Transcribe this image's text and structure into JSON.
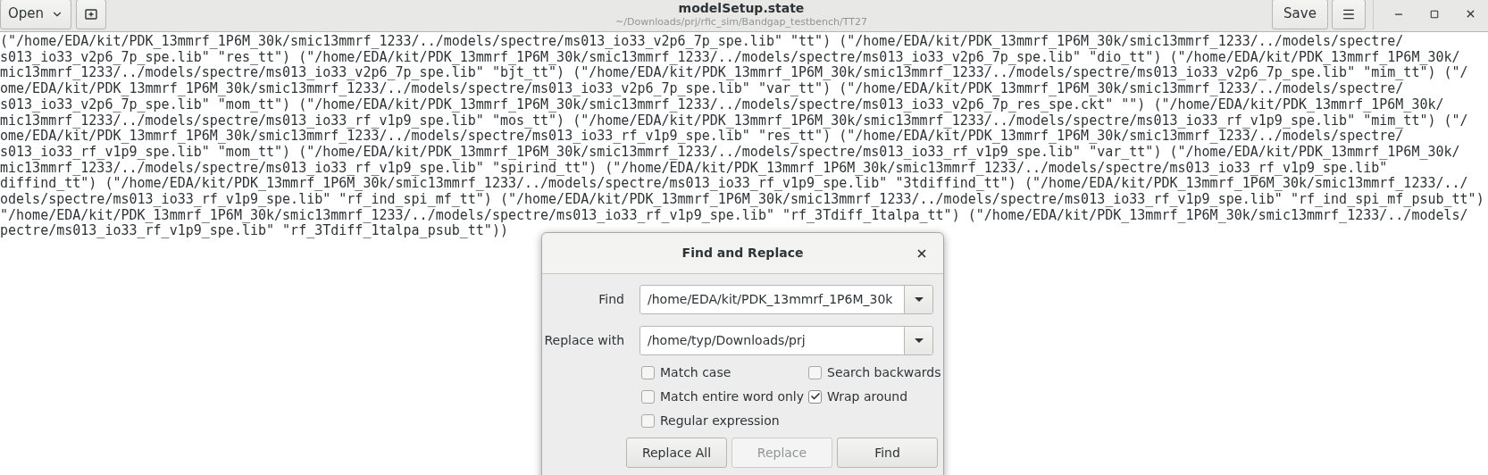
{
  "header_bar": {
    "open_button": "Open",
    "title": "modelSetup.state",
    "subtitle": "~/Downloads/prj/rfic_sim/Bandgap_testbench/TT27",
    "save_button": "Save"
  },
  "editor": {
    "lines": [
      "(\"/home/EDA/kit/PDK_13mmrf_1P6M_30k/smic13mmrf_1233/../models/spectre/ms013_io33_v2p6_7p_spe.lib\" \"tt\") (\"/home/EDA/kit/PDK_13mmrf_1P6M_30k/smic13mmrf_1233/../models/spectre/",
      "s013_io33_v2p6_7p_spe.lib\" \"res_tt\") (\"/home/EDA/kit/PDK_13mmrf_1P6M_30k/smic13mmrf_1233/../models/spectre/ms013_io33_v2p6_7p_spe.lib\" \"dio_tt\") (\"/home/EDA/kit/PDK_13mmrf_1P6M_30k/",
      "mic13mmrf_1233/../models/spectre/ms013_io33_v2p6_7p_spe.lib\" \"bjt_tt\") (\"/home/EDA/kit/PDK_13mmrf_1P6M_30k/smic13mmrf_1233/../models/spectre/ms013_io33_v2p6_7p_spe.lib\" \"mim_tt\") (\"/",
      "ome/EDA/kit/PDK_13mmrf_1P6M_30k/smic13mmrf_1233/../models/spectre/ms013_io33_v2p6_7p_spe.lib\" \"var_tt\") (\"/home/EDA/kit/PDK_13mmrf_1P6M_30k/smic13mmrf_1233/../models/spectre/",
      "s013_io33_v2p6_7p_spe.lib\" \"mom_tt\") (\"/home/EDA/kit/PDK_13mmrf_1P6M_30k/smic13mmrf_1233/../models/spectre/ms013_io33_v2p6_7p_res_spe.ckt\" \"\") (\"/home/EDA/kit/PDK_13mmrf_1P6M_30k/",
      "mic13mmrf_1233/../models/spectre/ms013_io33_rf_v1p9_spe.lib\" \"mos_tt\") (\"/home/EDA/kit/PDK_13mmrf_1P6M_30k/smic13mmrf_1233/../models/spectre/ms013_io33_rf_v1p9_spe.lib\" \"mim_tt\") (\"/",
      "ome/EDA/kit/PDK_13mmrf_1P6M_30k/smic13mmrf_1233/../models/spectre/ms013_io33_rf_v1p9_spe.lib\" \"res_tt\") (\"/home/EDA/kit/PDK_13mmrf_1P6M_30k/smic13mmrf_1233/../models/spectre/",
      "s013_io33_rf_v1p9_spe.lib\" \"mom_tt\") (\"/home/EDA/kit/PDK_13mmrf_1P6M_30k/smic13mmrf_1233/../models/spectre/ms013_io33_rf_v1p9_spe.lib\" \"var_tt\") (\"/home/EDA/kit/PDK_13mmrf_1P6M_30k/",
      "mic13mmrf_1233/../models/spectre/ms013_io33_rf_v1p9_spe.lib\" \"spirind_tt\") (\"/home/EDA/kit/PDK_13mmrf_1P6M_30k/smic13mmrf_1233/../models/spectre/ms013_io33_rf_v1p9_spe.lib\"",
      "diffind_tt\") (\"/home/EDA/kit/PDK_13mmrf_1P6M_30k/smic13mmrf_1233/../models/spectre/ms013_io33_rf_v1p9_spe.lib\" \"3tdiffind_tt\") (\"/home/EDA/kit/PDK_13mmrf_1P6M_30k/smic13mmrf_1233/../",
      "odels/spectre/ms013_io33_rf_v1p9_spe.lib\" \"rf_ind_spi_mf_tt\") (\"/home/EDA/kit/PDK_13mmrf_1P6M_30k/smic13mmrf_1233/../models/spectre/ms013_io33_rf_v1p9_spe.lib\" \"rf_ind_spi_mf_psub_tt\")",
      "\"/home/EDA/kit/PDK_13mmrf_1P6M_30k/smic13mmrf_1233/../models/spectre/ms013_io33_rf_v1p9_spe.lib\" \"rf_3Tdiff_1talpa_tt\") (\"/home/EDA/kit/PDK_13mmrf_1P6M_30k/smic13mmrf_1233/../models/",
      "pectre/ms013_io33_rf_v1p9_spe.lib\" \"rf_3Tdiff_1talpa_psub_tt\"))"
    ]
  },
  "dialog": {
    "title": "Find and Replace",
    "fields": [
      {
        "label": "Find",
        "value": "/home/EDA/kit/PDK_13mmrf_1P6M_30k"
      },
      {
        "label": "Replace with",
        "value": "/home/typ/Downloads/prj"
      }
    ],
    "options": [
      {
        "label": "Match case",
        "checked": false
      },
      {
        "label": "Search backwards",
        "checked": false
      },
      {
        "label": "Match entire word only",
        "checked": false
      },
      {
        "label": "Wrap around",
        "checked": true
      },
      {
        "label": "Regular expression",
        "checked": false
      }
    ],
    "buttons": [
      {
        "label": "Replace All",
        "disabled": false
      },
      {
        "label": "Replace",
        "disabled": true
      },
      {
        "label": "Find",
        "disabled": false
      }
    ]
  }
}
